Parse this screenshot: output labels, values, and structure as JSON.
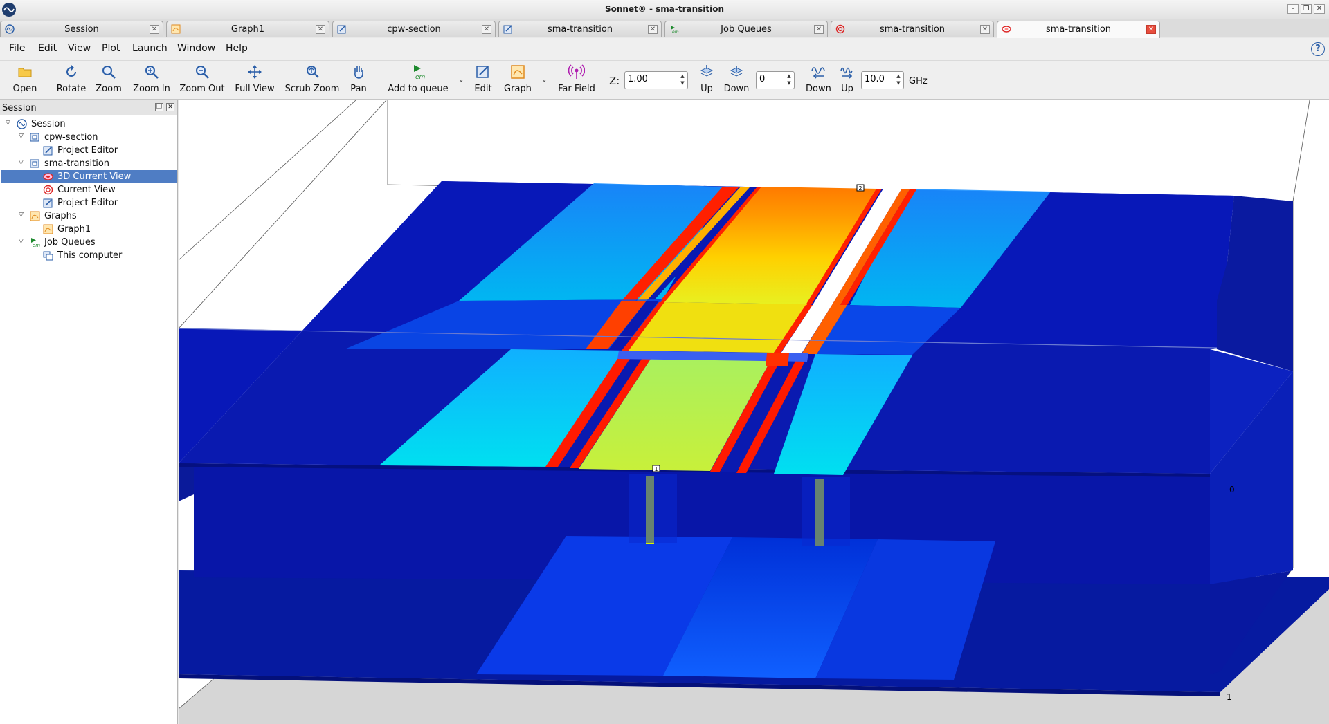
{
  "window": {
    "title": "Sonnet® - sma-transition"
  },
  "tabs": [
    {
      "label": "Session",
      "icon": "session-icon"
    },
    {
      "label": "Graph1",
      "icon": "graph-icon"
    },
    {
      "label": "cpw-section",
      "icon": "project-editor-icon"
    },
    {
      "label": "sma-transition",
      "icon": "project-editor-icon"
    },
    {
      "label": "Job Queues",
      "icon": "em-icon"
    },
    {
      "label": "sma-transition",
      "icon": "current-view-icon"
    },
    {
      "label": "sma-transition",
      "icon": "3d-current-view-icon",
      "active": true
    }
  ],
  "menu": [
    "File",
    "Edit",
    "View",
    "Plot",
    "Launch",
    "Window",
    "Help"
  ],
  "toolbar": {
    "open": "Open",
    "rotate": "Rotate",
    "zoom": "Zoom",
    "zoom_in": "Zoom In",
    "zoom_out": "Zoom Out",
    "full_view": "Full View",
    "scrub_zoom": "Scrub Zoom",
    "pan": "Pan",
    "add_to_queue": "Add to queue",
    "edit": "Edit",
    "graph": "Graph",
    "far_field": "Far Field",
    "z_label": "Z:",
    "z_value": "1.00",
    "level_up": "Up",
    "level_down": "Down",
    "level_value": "0",
    "freq_down": "Down",
    "freq_up": "Up",
    "freq_value": "10.0",
    "freq_unit": "GHz"
  },
  "session_panel": {
    "title": "Session",
    "tree": [
      {
        "label": "Session",
        "level": 0,
        "expanded": true,
        "icon": "session-icon"
      },
      {
        "label": "cpw-section",
        "level": 1,
        "expanded": true,
        "icon": "project-icon"
      },
      {
        "label": "Project Editor",
        "level": 2,
        "icon": "project-editor-icon"
      },
      {
        "label": "sma-transition",
        "level": 1,
        "expanded": true,
        "icon": "project-icon"
      },
      {
        "label": "3D Current View",
        "level": 2,
        "icon": "3d-current-view-icon",
        "selected": true
      },
      {
        "label": "Current View",
        "level": 2,
        "icon": "current-view-icon"
      },
      {
        "label": "Project Editor",
        "level": 2,
        "icon": "project-editor-icon"
      },
      {
        "label": "Graphs",
        "level": 1,
        "expanded": true,
        "icon": "graph-icon"
      },
      {
        "label": "Graph1",
        "level": 2,
        "icon": "graph-icon"
      },
      {
        "label": "Job Queues",
        "level": 1,
        "expanded": true,
        "icon": "em-icon"
      },
      {
        "label": "This computer",
        "level": 2,
        "icon": "computer-icon"
      }
    ]
  },
  "viewport": {
    "port_labels": [
      "2",
      "1"
    ],
    "level_labels": [
      "0",
      "1"
    ]
  }
}
